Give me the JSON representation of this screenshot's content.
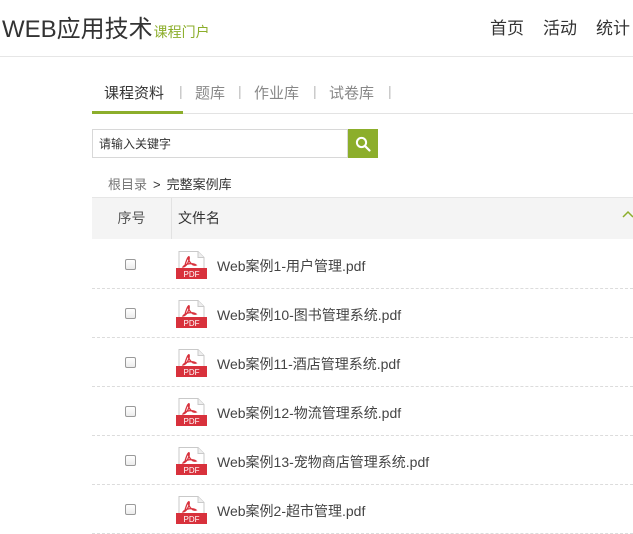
{
  "header": {
    "brand": "WEB应用技术",
    "brand_sub": "课程门户",
    "nav": [
      "首页",
      "活动",
      "统计"
    ]
  },
  "tabs": [
    "课程资料",
    "题库",
    "作业库",
    "试卷库"
  ],
  "tab_separator": "|",
  "search": {
    "placeholder": "请输入关键字"
  },
  "breadcrumb": {
    "root": "根目录",
    "arrow": ">",
    "current": "完整案例库"
  },
  "table": {
    "col_no": "序号",
    "col_name": "文件名",
    "files": [
      "Web案例1-用户管理.pdf",
      "Web案例10-图书管理系统.pdf",
      "Web案例11-酒店管理系统.pdf",
      "Web案例12-物流管理系统.pdf",
      "Web案例13-宠物商店管理系统.pdf",
      "Web案例2-超市管理.pdf"
    ]
  },
  "icon_label": "PDF",
  "colors": {
    "accent": "#8cae2b",
    "pdf_red": "#d8313c"
  }
}
